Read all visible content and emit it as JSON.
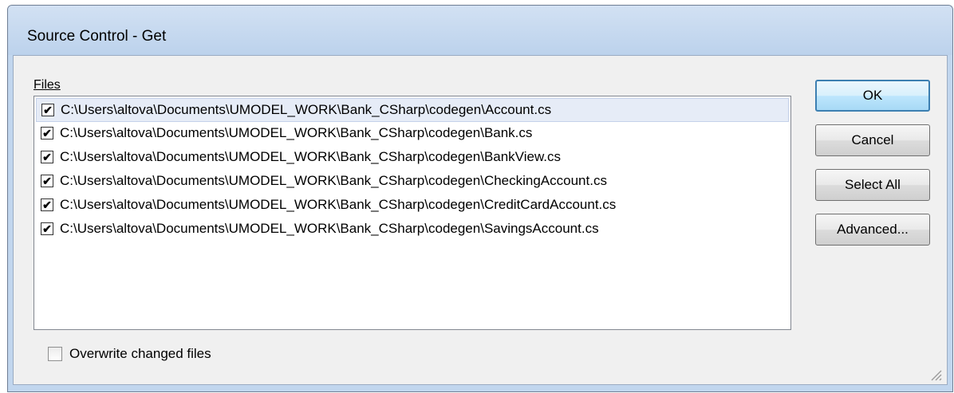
{
  "window": {
    "title": "Source Control - Get"
  },
  "files_label": "Files",
  "files": [
    {
      "path": "C:\\Users\\altova\\Documents\\UMODEL_WORK\\Bank_CSharp\\codegen\\Account.cs",
      "checked": true,
      "selected": true
    },
    {
      "path": "C:\\Users\\altova\\Documents\\UMODEL_WORK\\Bank_CSharp\\codegen\\Bank.cs",
      "checked": true,
      "selected": false
    },
    {
      "path": "C:\\Users\\altova\\Documents\\UMODEL_WORK\\Bank_CSharp\\codegen\\BankView.cs",
      "checked": true,
      "selected": false
    },
    {
      "path": "C:\\Users\\altova\\Documents\\UMODEL_WORK\\Bank_CSharp\\codegen\\CheckingAccount.cs",
      "checked": true,
      "selected": false
    },
    {
      "path": "C:\\Users\\altova\\Documents\\UMODEL_WORK\\Bank_CSharp\\codegen\\CreditCardAccount.cs",
      "checked": true,
      "selected": false
    },
    {
      "path": "C:\\Users\\altova\\Documents\\UMODEL_WORK\\Bank_CSharp\\codegen\\SavingsAccount.cs",
      "checked": true,
      "selected": false
    }
  ],
  "buttons": {
    "ok": "OK",
    "cancel": "Cancel",
    "select_all": "Select All",
    "advanced": "Advanced..."
  },
  "overwrite": {
    "label": "Overwrite changed files",
    "checked": false
  },
  "colors": {
    "frame": "#c1d6ee",
    "client": "#f0f0f0",
    "selection": "#e6ecf7",
    "default_button_border": "#3c7fb1"
  },
  "icons": {
    "checkbox_checked": "check-mark",
    "resize_grip": "size-grip"
  }
}
